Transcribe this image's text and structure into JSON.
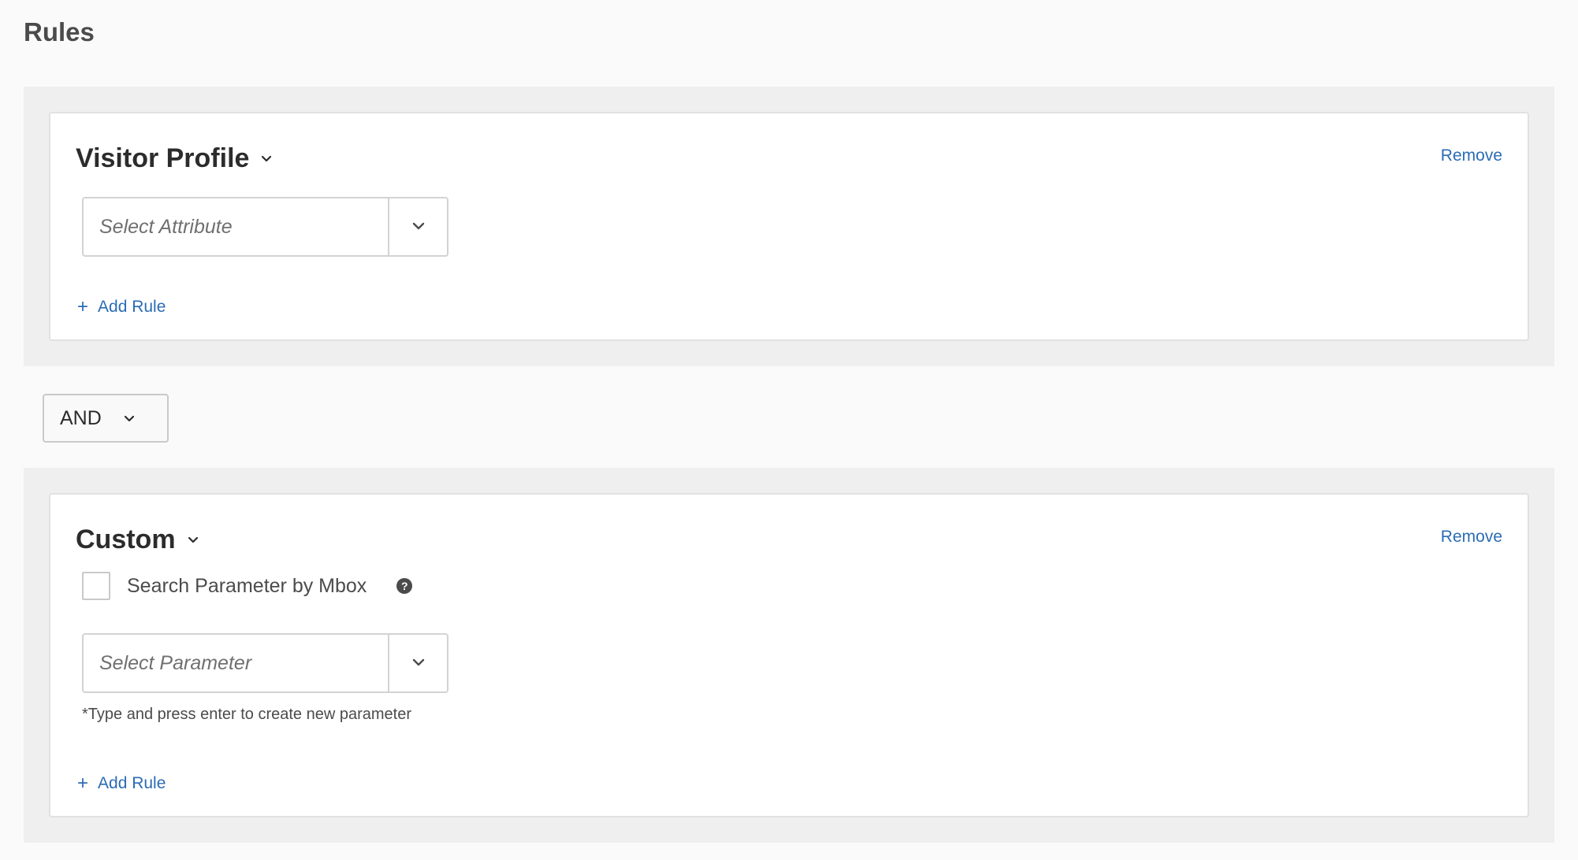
{
  "page": {
    "title": "Rules"
  },
  "groups": [
    {
      "title": "Visitor Profile",
      "remove_label": "Remove",
      "select_placeholder": "Select Attribute",
      "add_rule_label": "Add Rule"
    },
    {
      "title": "Custom",
      "remove_label": "Remove",
      "checkbox_label": "Search Parameter by Mbox",
      "checkbox_checked": false,
      "help_icon": "question-circle-icon",
      "select_placeholder": "Select Parameter",
      "hint": "*Type and press enter to create new parameter",
      "add_rule_label": "Add Rule"
    }
  ],
  "operator": {
    "value": "AND"
  },
  "colors": {
    "link": "#2b6cb4",
    "group_background": "#efefef",
    "card_border": "#e1e1e1"
  }
}
